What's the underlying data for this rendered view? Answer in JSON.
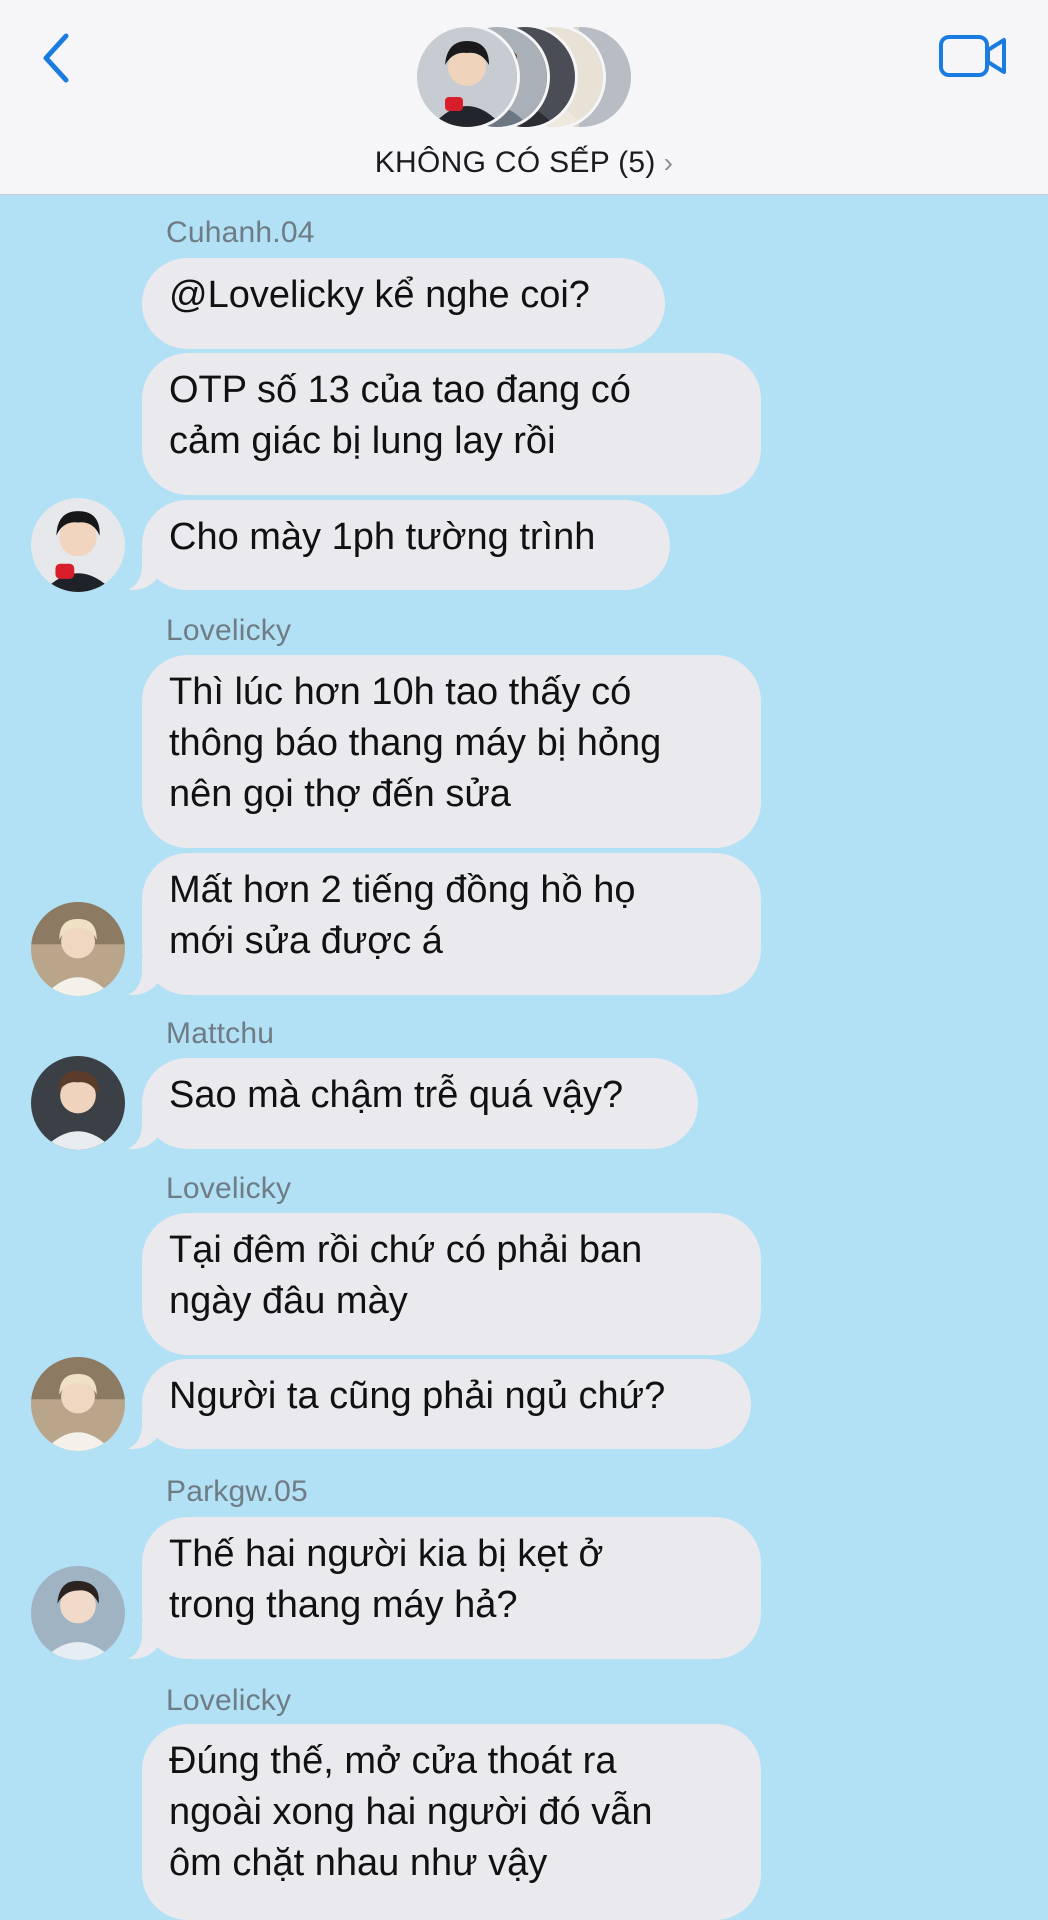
{
  "header": {
    "back_icon": "chevron-left-icon",
    "video_icon": "video-camera-icon",
    "group_name": "KHÔNG CÓ SẾP (5)",
    "chevron": "›",
    "accent_color": "#1a7be0"
  },
  "chat": {
    "background_color": "#b2e0f5",
    "bubble_color": "#e9e9ee",
    "groups": [
      {
        "sender": "Cuhanh.04",
        "avatar": "avatar-cuhanh",
        "messages": [
          "@Lovelicky kể nghe coi?",
          "OTP số 13 của tao đang có\ncảm giác bị lung lay rồi",
          "Cho mày 1ph tường trình"
        ]
      },
      {
        "sender": "Lovelicky",
        "avatar": "avatar-lovelicky",
        "messages": [
          "Thì lúc hơn 10h tao thấy có\nthông báo thang máy bị hỏng\nnên gọi thợ đến sửa",
          "Mất hơn 2 tiếng đồng hồ họ\nmới sửa được á"
        ]
      },
      {
        "sender": "Mattchu",
        "avatar": "avatar-mattchu",
        "messages": [
          "Sao mà chậm trễ quá vậy?"
        ]
      },
      {
        "sender": "Lovelicky",
        "avatar": "avatar-lovelicky",
        "messages": [
          "Tại đêm rồi chứ có phải ban\nngày đâu mày",
          "Người ta cũng phải ngủ chứ?"
        ]
      },
      {
        "sender": "Parkgw.05",
        "avatar": "avatar-parkgw",
        "messages": [
          "Thế hai người kia bị kẹt ở\ntrong thang máy hả?"
        ]
      },
      {
        "sender": "Lovelicky",
        "avatar": "",
        "messages": [
          "Đúng thế, mở cửa thoát ra\nngoài xong hai người đó vẫn\nôm chặt nhau như vậy"
        ]
      }
    ]
  }
}
